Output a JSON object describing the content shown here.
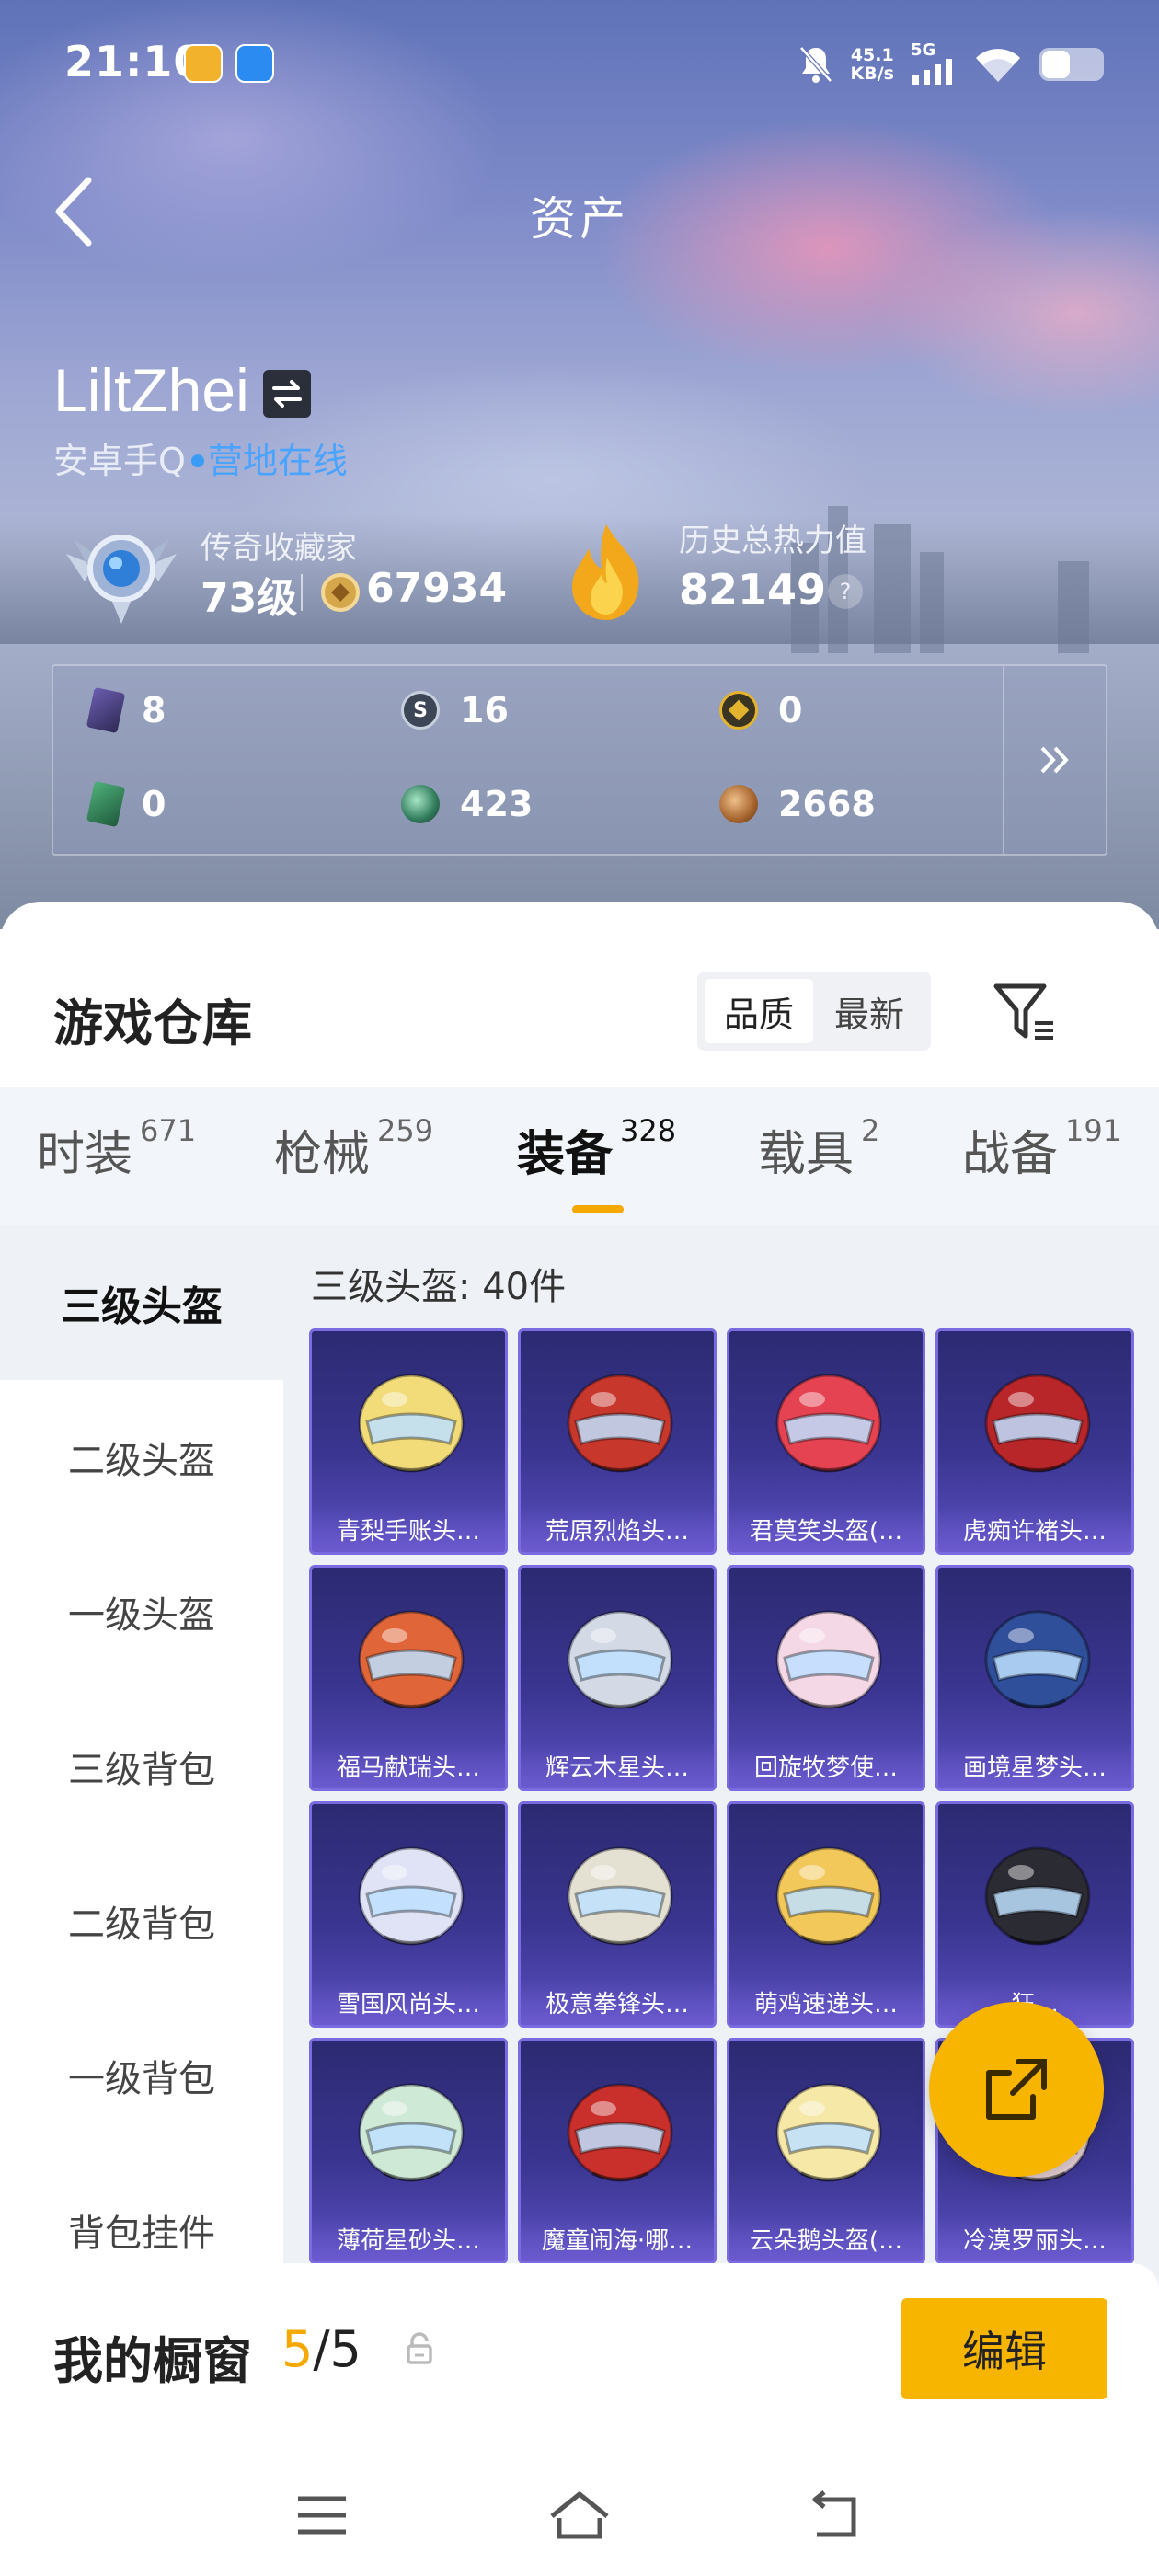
{
  "status_bar": {
    "time": "21:10",
    "net_speed_value": "45.1",
    "net_speed_unit": "KB/s",
    "signal": "5G"
  },
  "header": {
    "title": "资产"
  },
  "profile": {
    "username": "LiltZhei",
    "platform": "安卓手Q",
    "online_status": "营地在线",
    "rank_title": "传奇收藏家",
    "rank_level": "73级",
    "coins": "67934",
    "heat_title": "历史总热力值",
    "heat_value": "82149",
    "help_glyph": "?"
  },
  "stats": [
    {
      "icon": "card-purple-icon",
      "value": "8"
    },
    {
      "icon": "badge-s-icon",
      "value": "16"
    },
    {
      "icon": "gold-medal-icon",
      "value": "0"
    },
    {
      "icon": "card-green-icon",
      "value": "0"
    },
    {
      "icon": "green-orb-icon",
      "value": "423"
    },
    {
      "icon": "bronze-coin-icon",
      "value": "2668"
    }
  ],
  "warehouse": {
    "title": "游戏仓库",
    "sort_options": [
      "品质",
      "最新"
    ],
    "active_sort": "品质"
  },
  "tabs": [
    {
      "label": "时装",
      "count": "671"
    },
    {
      "label": "枪械",
      "count": "259"
    },
    {
      "label": "装备",
      "count": "328"
    },
    {
      "label": "载具",
      "count": "2"
    },
    {
      "label": "战备",
      "count": "191"
    }
  ],
  "active_tab": "装备",
  "sidebar": [
    {
      "label": "三级头盔"
    },
    {
      "label": "二级头盔"
    },
    {
      "label": "一级头盔"
    },
    {
      "label": "三级背包"
    },
    {
      "label": "二级背包"
    },
    {
      "label": "一级背包"
    },
    {
      "label": "背包挂件"
    }
  ],
  "category_count_label": "三级头盔: 40件",
  "items": [
    {
      "name": "青梨手账头…",
      "color": "#f2dc7a"
    },
    {
      "name": "荒原烈焰头…",
      "color": "#c8372c"
    },
    {
      "name": "君莫笑头盔(…",
      "color": "#e64352"
    },
    {
      "name": "虎痴许褚头…",
      "color": "#b8262a"
    },
    {
      "name": "福马献瑞头…",
      "color": "#e0663a"
    },
    {
      "name": "辉云木星头…",
      "color": "#d3dae6"
    },
    {
      "name": "回旋牧梦使…",
      "color": "#f4d8e6"
    },
    {
      "name": "画境星梦头…",
      "color": "#2f4f9a"
    },
    {
      "name": "雪国风尚头…",
      "color": "#dfe3f5"
    },
    {
      "name": "极意拳锋头…",
      "color": "#e4e0d2"
    },
    {
      "name": "萌鸡速递头…",
      "color": "#f2c85a"
    },
    {
      "name": "狂…",
      "color": "#2b2b33"
    },
    {
      "name": "薄荷星砂头…",
      "color": "#cfe9d7"
    },
    {
      "name": "魔童闹海·哪…",
      "color": "#c9302c"
    },
    {
      "name": "云朵鹅头盔(…",
      "color": "#f6e8a6"
    },
    {
      "name": "冷漠罗丽头…",
      "color": "#e8d2d6"
    }
  ],
  "showcase": {
    "title": "我的橱窗",
    "count_current": "5",
    "count_total": "/5",
    "edit_label": "编辑"
  },
  "accent_color": "#f7b500"
}
